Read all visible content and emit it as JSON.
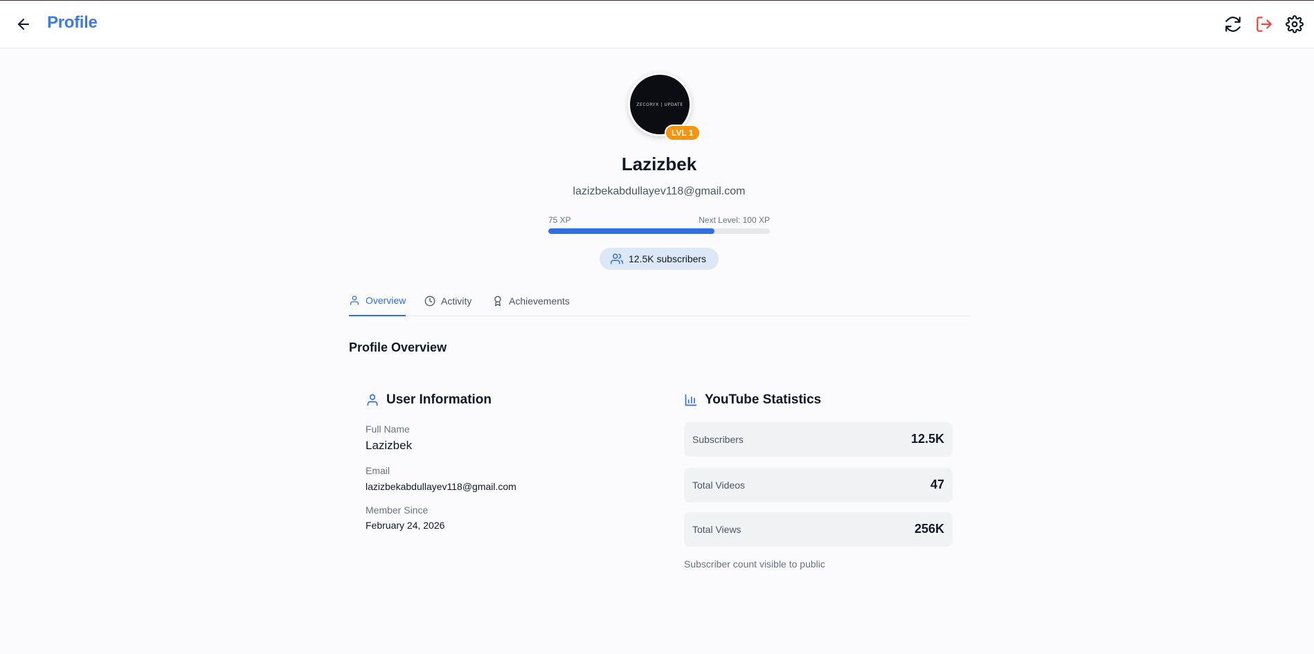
{
  "header": {
    "title": "Profile",
    "icons": [
      "back-arrow-icon",
      "refresh-icon",
      "logout-icon",
      "settings-icon"
    ],
    "accent_color": "#3b7be8",
    "logout_color": "#ef4444"
  },
  "profile": {
    "avatar_text": "ZECORYX | UPDATE",
    "level_badge": "LVL 1",
    "name": "Lazizbek",
    "email": "lazizbekabdullayev118@gmail.com",
    "xp": {
      "current_label": "75 XP",
      "next_label": "Next Level: 100 XP",
      "progress_fraction": 0.75
    },
    "subscribers_pill": "12.5K subscribers"
  },
  "tabs": [
    {
      "label": "Overview",
      "icon": "user-icon",
      "active": true
    },
    {
      "label": "Activity",
      "icon": "clock-icon",
      "active": false
    },
    {
      "label": "Achievements",
      "icon": "award-icon",
      "active": false
    }
  ],
  "overview": {
    "section_title": "Profile Overview",
    "user_info": {
      "title": "User Information",
      "fields": [
        {
          "label": "Full Name",
          "value": "Lazizbek"
        },
        {
          "label": "Email",
          "value": "lazizbekabdullayev118@gmail.com"
        },
        {
          "label": "Member Since",
          "value": "February 24, 2026"
        }
      ]
    },
    "youtube_stats": {
      "title": "YouTube Statistics",
      "stats": [
        {
          "label": "Subscribers",
          "value": "12.5K"
        },
        {
          "label": "Total Videos",
          "value": "47"
        },
        {
          "label": "Total Views",
          "value": "256K"
        }
      ],
      "note": "Subscriber count visible to public"
    }
  },
  "colors": {
    "primary": "#2f6fe0",
    "badge": "#f5940f",
    "pill_bg": "#dde8f7"
  }
}
